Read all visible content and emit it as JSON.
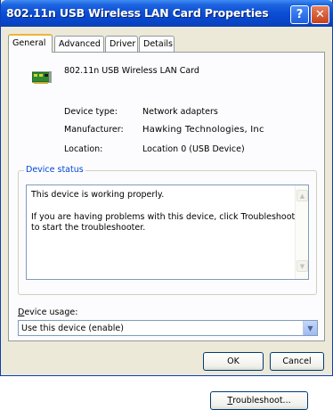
{
  "window": {
    "title": "802.11n USB Wireless LAN Card Properties",
    "help_glyph": "?",
    "close_glyph": "✕"
  },
  "tabs": [
    {
      "label": "General",
      "active": true
    },
    {
      "label": "Advanced",
      "active": false
    },
    {
      "label": "Driver",
      "active": false
    },
    {
      "label": "Details",
      "active": false
    }
  ],
  "device": {
    "icon": "network-card-icon",
    "name": "802.11n USB Wireless LAN Card",
    "properties": [
      {
        "label": "Device type:",
        "value": "Network adapters"
      },
      {
        "label": "Manufacturer:",
        "value": "Hawking Technologies, Inc"
      },
      {
        "label": "Location:",
        "value": "Location 0 (USB Device)"
      }
    ]
  },
  "status": {
    "group_label": "Device status",
    "line1": "This device is working properly.",
    "line2": "If you are having problems with this device, click Troubleshoot to start the troubleshooter."
  },
  "buttons": {
    "troubleshoot_rest": "roubleshoot...",
    "troubleshoot_mnemonic": "T",
    "ok": "OK",
    "cancel": "Cancel"
  },
  "usage": {
    "label_mnemonic": "D",
    "label_rest": "evice usage:",
    "selected": "Use this device (enable)"
  },
  "colors": {
    "titlebar": "#0a4dd6",
    "face": "#ece9d8",
    "group_label": "#0046d5",
    "tab_highlight": "#f0b33b"
  }
}
